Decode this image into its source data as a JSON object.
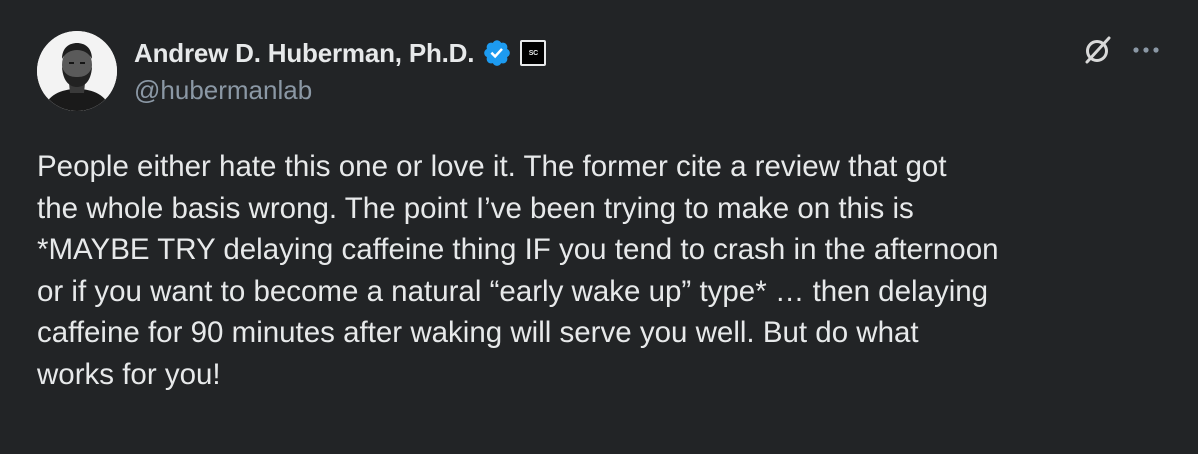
{
  "author": {
    "display_name": "Andrew D. Huberman, Ph.D.",
    "handle": "@hubermanlab",
    "affiliation_badge": "SC",
    "verified_color": "#1d9bf0"
  },
  "icons": {
    "verified": "verified-badge-icon",
    "grok": "grok-icon",
    "more": "more-options-icon"
  },
  "post": {
    "lines": [
      "People either hate this one or love it. The former cite a review that got",
      "the whole basis wrong. The point I’ve been trying to make on this is",
      "*MAYBE TRY delaying caffeine thing IF you tend to crash in the afternoon",
      "or if you want to become a natural “early wake up” type* … then delaying",
      "caffeine for 90 minutes after waking will serve you well. But do what",
      "works for you!"
    ]
  },
  "colors": {
    "background": "#222426",
    "text": "#e7e9ea",
    "secondary_text": "#8b98a5"
  }
}
